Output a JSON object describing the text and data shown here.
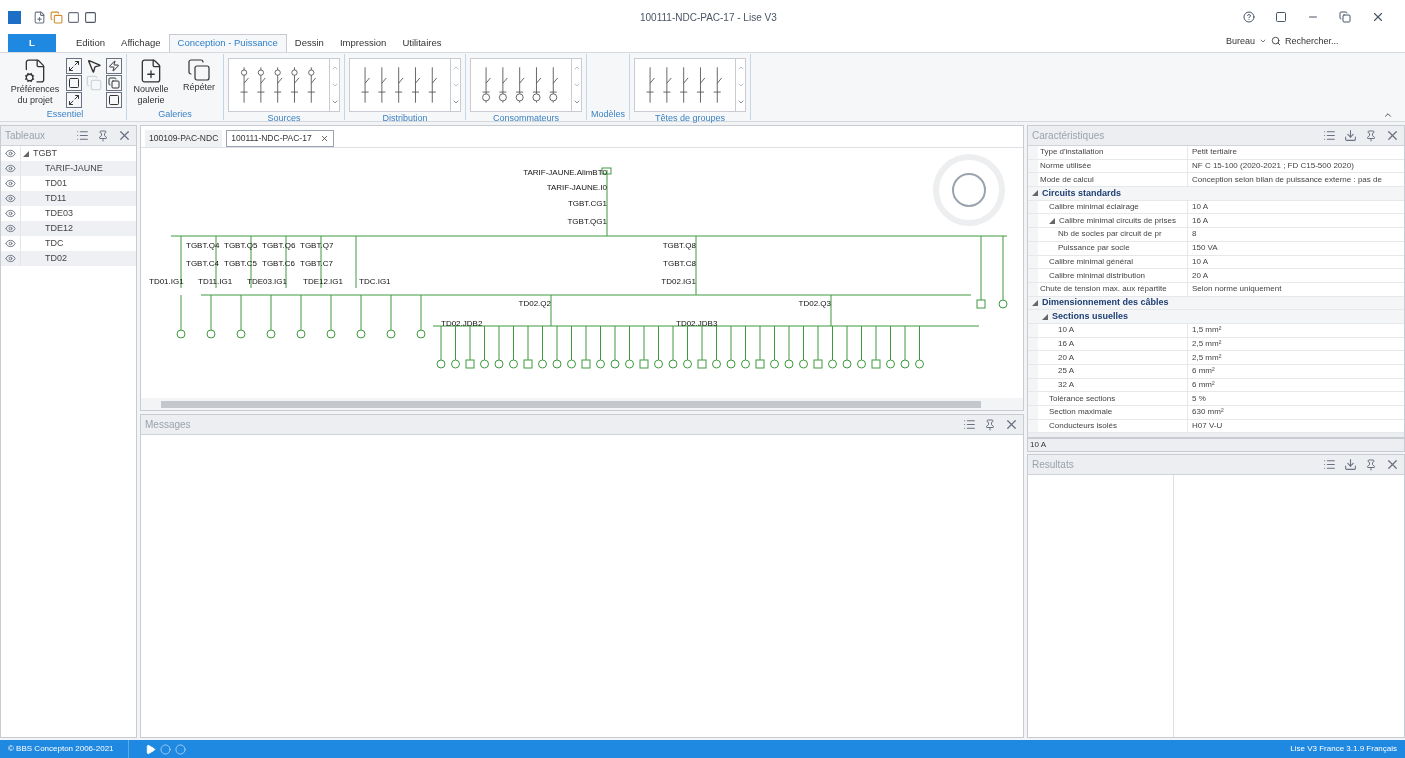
{
  "window": {
    "title": "100111-NDC-PAC-17 - Lise V3"
  },
  "ribbon_tabs": [
    {
      "label": "L",
      "kind": "app",
      "selected": false
    },
    {
      "label": "Edition",
      "kind": "tab",
      "selected": false
    },
    {
      "label": "Affichage",
      "kind": "tab",
      "selected": false
    },
    {
      "label": "Conception - Puissance",
      "kind": "tab",
      "selected": true
    },
    {
      "label": "Dessin",
      "kind": "tab",
      "selected": false
    },
    {
      "label": "Impression",
      "kind": "tab",
      "selected": false
    },
    {
      "label": "Utilitaires",
      "kind": "tab",
      "selected": false
    }
  ],
  "workspace": {
    "label": "Bureau"
  },
  "search": {
    "placeholder": "Rechercher..."
  },
  "ribbon_groups": [
    {
      "name": "Essentiel",
      "kind": "essentiel",
      "buttons": [
        "Préférences du projet"
      ]
    },
    {
      "name": "Galeries",
      "kind": "buttons",
      "buttons": [
        "Nouvelle galerie",
        "Répéter"
      ]
    },
    {
      "name": "Sources",
      "kind": "gallery"
    },
    {
      "name": "Distribution",
      "kind": "gallery"
    },
    {
      "name": "Consommateurs",
      "kind": "gallery"
    },
    {
      "name": "Modèles",
      "kind": "empty"
    },
    {
      "name": "Têtes de groupes",
      "kind": "gallery"
    }
  ],
  "tableaux": {
    "title": "Tableaux",
    "items": [
      {
        "label": "TGBT",
        "expanded": true,
        "children": [
          {
            "label": "TARIF-JAUNE"
          },
          {
            "label": "TD01"
          },
          {
            "label": "TD11"
          },
          {
            "label": "TDE03"
          },
          {
            "label": "TDE12"
          },
          {
            "label": "TDC"
          },
          {
            "label": "TD02"
          }
        ]
      }
    ]
  },
  "doc_tabs": [
    {
      "label": "100109-PAC-NDC",
      "selected": false
    },
    {
      "label": "100111-NDC-PAC-17",
      "selected": true
    }
  ],
  "diagram": {
    "labels": [
      "TARIF-JAUNE.AlimBT0",
      "TARIF-JAUNE.I0",
      "TGBT.CG1",
      "TGBT.QG1",
      "TGBT.Q8",
      "TGBT.C8",
      "TD02.IG1",
      "TD02.Q2",
      "TD02.Q3",
      "TD02.JDB2",
      "TD02.JDB3",
      "TGBT.Q4",
      "TGBT.Q5",
      "TGBT.Q6",
      "TGBT.Q7",
      "TGBT.C4",
      "TGBT.C5",
      "TGBT.C6",
      "TGBT.C7",
      "TD01.IG1",
      "TD11.IG1",
      "TDE03.IG1",
      "TDE12.IG1",
      "TDC.IG1"
    ]
  },
  "messages": {
    "title": "Messages"
  },
  "properties": {
    "title": "Caractéristiques",
    "rows": [
      {
        "label": "Type d'installation",
        "value": "Petit tertiaire"
      },
      {
        "label": "Norme utilisée",
        "value": "NF C 15-100 (2020-2021 ; FD C15-500 2020)"
      },
      {
        "label": "Mode de calcul",
        "value": "Conception selon bilan de puissance externe : pas de"
      },
      {
        "label": "Circuits standards",
        "kind": "category",
        "expanded": true,
        "children": [
          {
            "label": "Calibre minimal éclairage",
            "value": "10 A"
          },
          {
            "label": "Calibre minimal circuits de prises",
            "value": "16 A",
            "expanded": true,
            "children": [
              {
                "label": "Nb de socles par circuit de pr",
                "value": "8"
              },
              {
                "label": "Puissance par socle",
                "value": "150 VA"
              }
            ]
          },
          {
            "label": "Calibre minimal général",
            "value": "10 A"
          },
          {
            "label": "Calibre minimal distribution",
            "value": "20 A"
          }
        ]
      },
      {
        "label": "Chute de tension max. aux répartite",
        "value": "Selon norme uniquement"
      },
      {
        "label": "Dimensionnement des câbles",
        "kind": "category",
        "expanded": true,
        "children": [
          {
            "label": "Sections usuelles",
            "kind": "category",
            "expanded": true,
            "children": [
              {
                "label": "10 A",
                "value": "1,5 mm²"
              },
              {
                "label": "16 A",
                "value": "2,5 mm²"
              },
              {
                "label": "20 A",
                "value": "2,5 mm²"
              },
              {
                "label": "25 A",
                "value": "6 mm²"
              },
              {
                "label": "32 A",
                "value": "6 mm²"
              }
            ]
          },
          {
            "label": "Tolérance sections",
            "value": "5 %"
          },
          {
            "label": "Section maximale",
            "value": "630 mm²"
          },
          {
            "label": "Conducteurs isolés",
            "value": "H07 V-U"
          }
        ]
      }
    ],
    "description": "10 A"
  },
  "results": {
    "title": "Resultats"
  },
  "status_bar": {
    "left": "© BBS Concepton 2006-2021",
    "right": "Lise V3 France 3.1.9 Français"
  }
}
